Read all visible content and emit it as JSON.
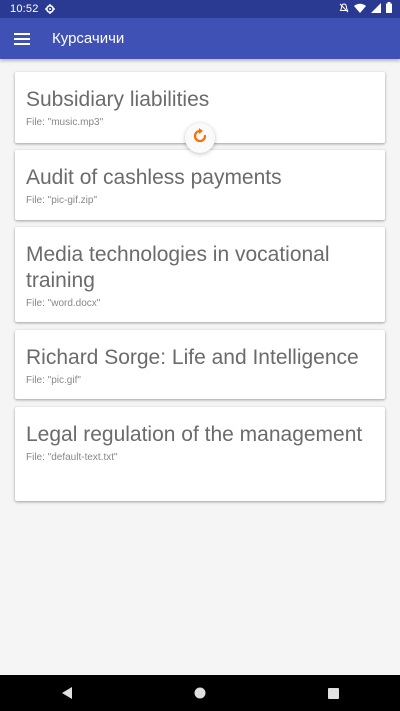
{
  "status_bar": {
    "time": "10:52",
    "icons": [
      "gear-icon",
      "do-not-disturb-icon",
      "wifi-icon",
      "signal-icon",
      "battery-icon"
    ]
  },
  "app_bar": {
    "title": "Курсачичи",
    "menu_icon": "hamburger-menu-icon",
    "color": "#3f51b5"
  },
  "refresh_indicator": {
    "icon": "refresh-icon",
    "color": "#ff6d00"
  },
  "courses": [
    {
      "title": "Subsidiary liabilities",
      "file": "File: \"music.mp3\""
    },
    {
      "title": "Audit of cashless payments",
      "file": "File: \"pic-gif.zip\""
    },
    {
      "title": "Media technologies in vocational training",
      "file": "File: \"word.docx\""
    },
    {
      "title": "Richard Sorge: Life and Intelligence",
      "file": "File: \"pic.gif\""
    },
    {
      "title": "Legal regulation of the management",
      "file": "File: \"default-text.txt\""
    }
  ],
  "nav_bar": {
    "icons": [
      "back-icon",
      "home-icon",
      "recents-icon"
    ]
  }
}
